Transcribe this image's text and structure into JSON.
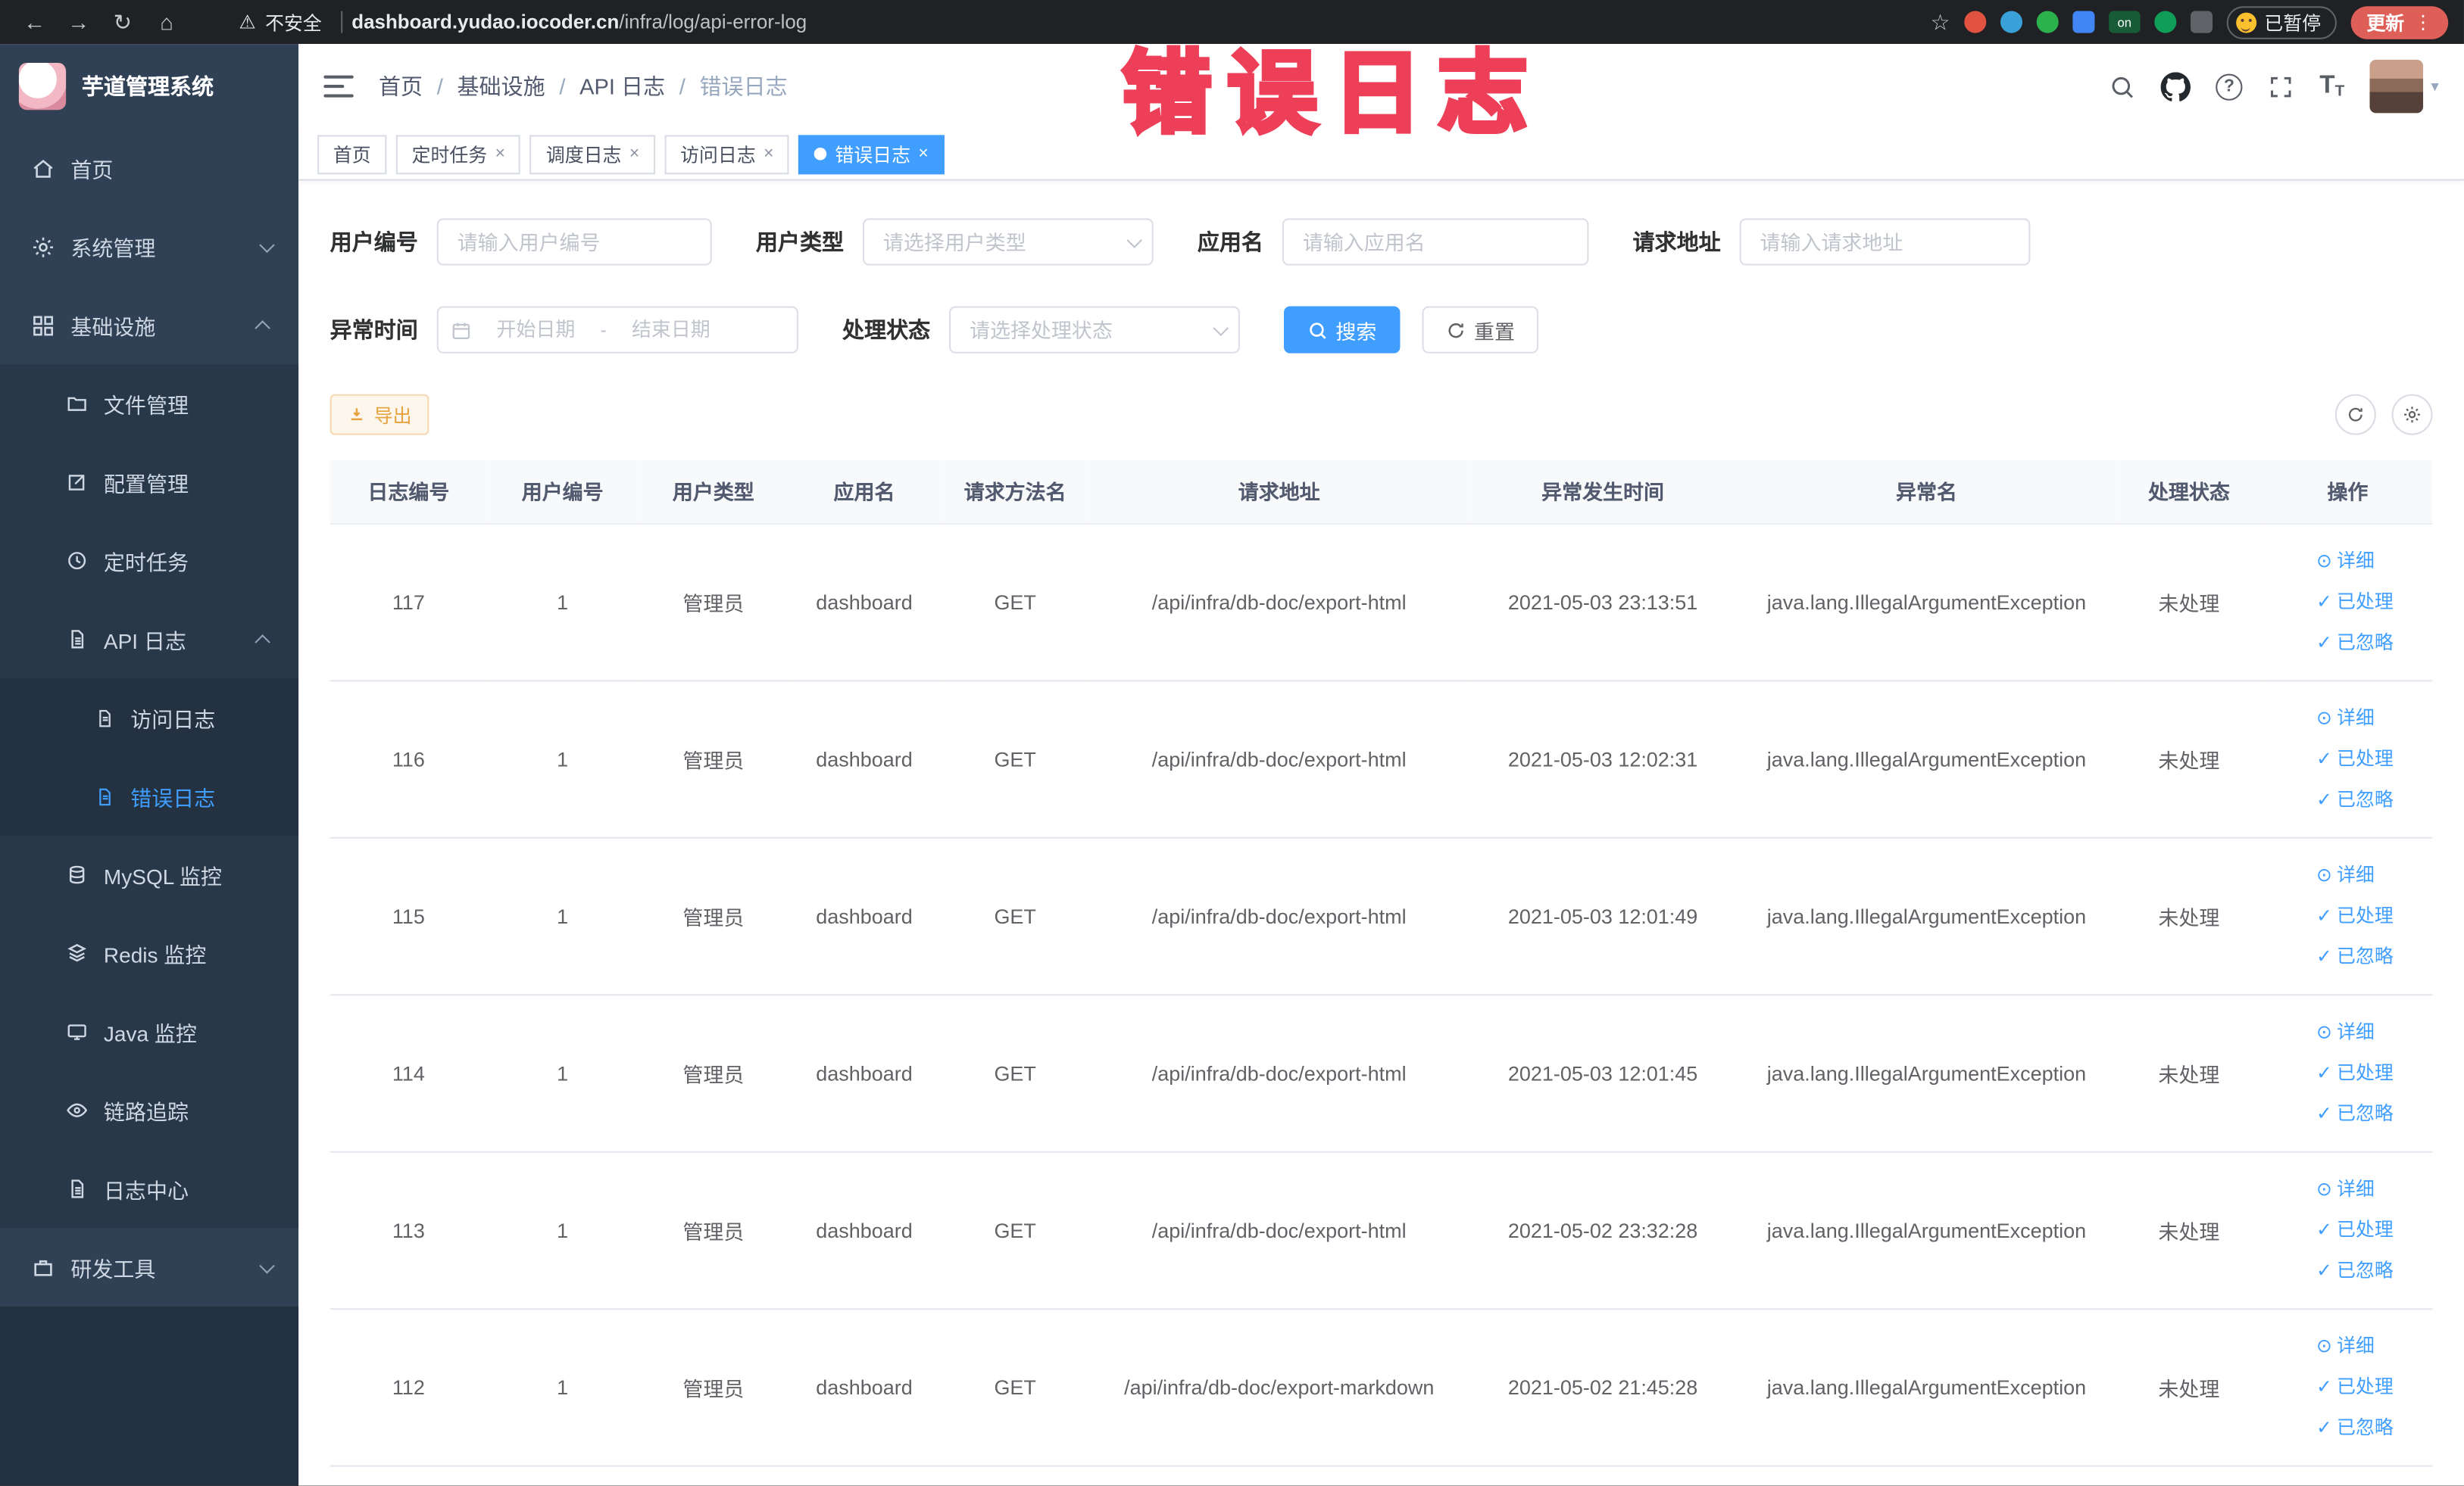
{
  "icons": {
    "back": "←",
    "forward": "→",
    "reload": "↻",
    "home_glyph": "⌂",
    "warning": "⚠",
    "star": "☆",
    "dots": "⋮",
    "close": "×",
    "caret": "▾",
    "question": "?",
    "text_size": "T",
    "detail": "⊙",
    "check": "✓"
  },
  "browser": {
    "security": "不安全",
    "url_domain": "dashboard.yudao.iocoder.cn",
    "url_path": "/infra/log/api-error-log",
    "ext_on_label": "on",
    "paused_label": "已暂停",
    "update_label": "更新"
  },
  "watermark": "错误日志",
  "sidebar": {
    "title": "芋道管理系统",
    "home": "首页",
    "system": "系统管理",
    "infra": "基础设施",
    "file": "文件管理",
    "config": "配置管理",
    "job": "定时任务",
    "api_log": "API 日志",
    "access_log": "访问日志",
    "error_log": "错误日志",
    "mysql": "MySQL 监控",
    "redis": "Redis 监控",
    "java": "Java 监控",
    "trace": "链路追踪",
    "log_center": "日志中心",
    "dev": "研发工具"
  },
  "breadcrumb": {
    "separator": "/",
    "items": [
      "首页",
      "基础设施",
      "API 日志",
      "错误日志"
    ]
  },
  "tabs": [
    {
      "label": "首页"
    },
    {
      "label": "定时任务"
    },
    {
      "label": "调度日志"
    },
    {
      "label": "访问日志"
    },
    {
      "label": "错误日志"
    }
  ],
  "filters": {
    "user_no": {
      "label": "用户编号",
      "placeholder": "请输入用户编号"
    },
    "user_type": {
      "label": "用户类型",
      "placeholder": "请选择用户类型"
    },
    "app_name": {
      "label": "应用名",
      "placeholder": "请输入应用名"
    },
    "req_url": {
      "label": "请求地址",
      "placeholder": "请输入请求地址"
    },
    "time": {
      "label": "异常时间",
      "start_placeholder": "开始日期",
      "end_placeholder": "结束日期",
      "separator": "-"
    },
    "status": {
      "label": "处理状态",
      "placeholder": "请选择处理状态"
    },
    "search_button": "搜索",
    "reset_button": "重置"
  },
  "toolbar": {
    "export_button": "导出"
  },
  "table": {
    "headers": [
      "日志编号",
      "用户编号",
      "用户类型",
      "应用名",
      "请求方法名",
      "请求地址",
      "异常发生时间",
      "异常名",
      "处理状态",
      "操作"
    ],
    "actions": {
      "detail": "详细",
      "processed": "已处理",
      "ignored": "已忽略"
    },
    "rows": [
      {
        "id": "117",
        "user_id": "1",
        "user_type": "管理员",
        "app": "dashboard",
        "method": "GET",
        "url": "/api/infra/db-doc/export-html",
        "time": "2021-05-03 23:13:51",
        "exception": "java.lang.IllegalArgumentException",
        "status": "未处理"
      },
      {
        "id": "116",
        "user_id": "1",
        "user_type": "管理员",
        "app": "dashboard",
        "method": "GET",
        "url": "/api/infra/db-doc/export-html",
        "time": "2021-05-03 12:02:31",
        "exception": "java.lang.IllegalArgumentException",
        "status": "未处理"
      },
      {
        "id": "115",
        "user_id": "1",
        "user_type": "管理员",
        "app": "dashboard",
        "method": "GET",
        "url": "/api/infra/db-doc/export-html",
        "time": "2021-05-03 12:01:49",
        "exception": "java.lang.IllegalArgumentException",
        "status": "未处理"
      },
      {
        "id": "114",
        "user_id": "1",
        "user_type": "管理员",
        "app": "dashboard",
        "method": "GET",
        "url": "/api/infra/db-doc/export-html",
        "time": "2021-05-03 12:01:45",
        "exception": "java.lang.IllegalArgumentException",
        "status": "未处理"
      },
      {
        "id": "113",
        "user_id": "1",
        "user_type": "管理员",
        "app": "dashboard",
        "method": "GET",
        "url": "/api/infra/db-doc/export-html",
        "time": "2021-05-02 23:32:28",
        "exception": "java.lang.IllegalArgumentException",
        "status": "未处理"
      },
      {
        "id": "112",
        "user_id": "1",
        "user_type": "管理员",
        "app": "dashboard",
        "method": "GET",
        "url": "/api/infra/db-doc/export-markdown",
        "time": "2021-05-02 21:45:28",
        "exception": "java.lang.IllegalArgumentException",
        "status": "未处理"
      }
    ]
  }
}
